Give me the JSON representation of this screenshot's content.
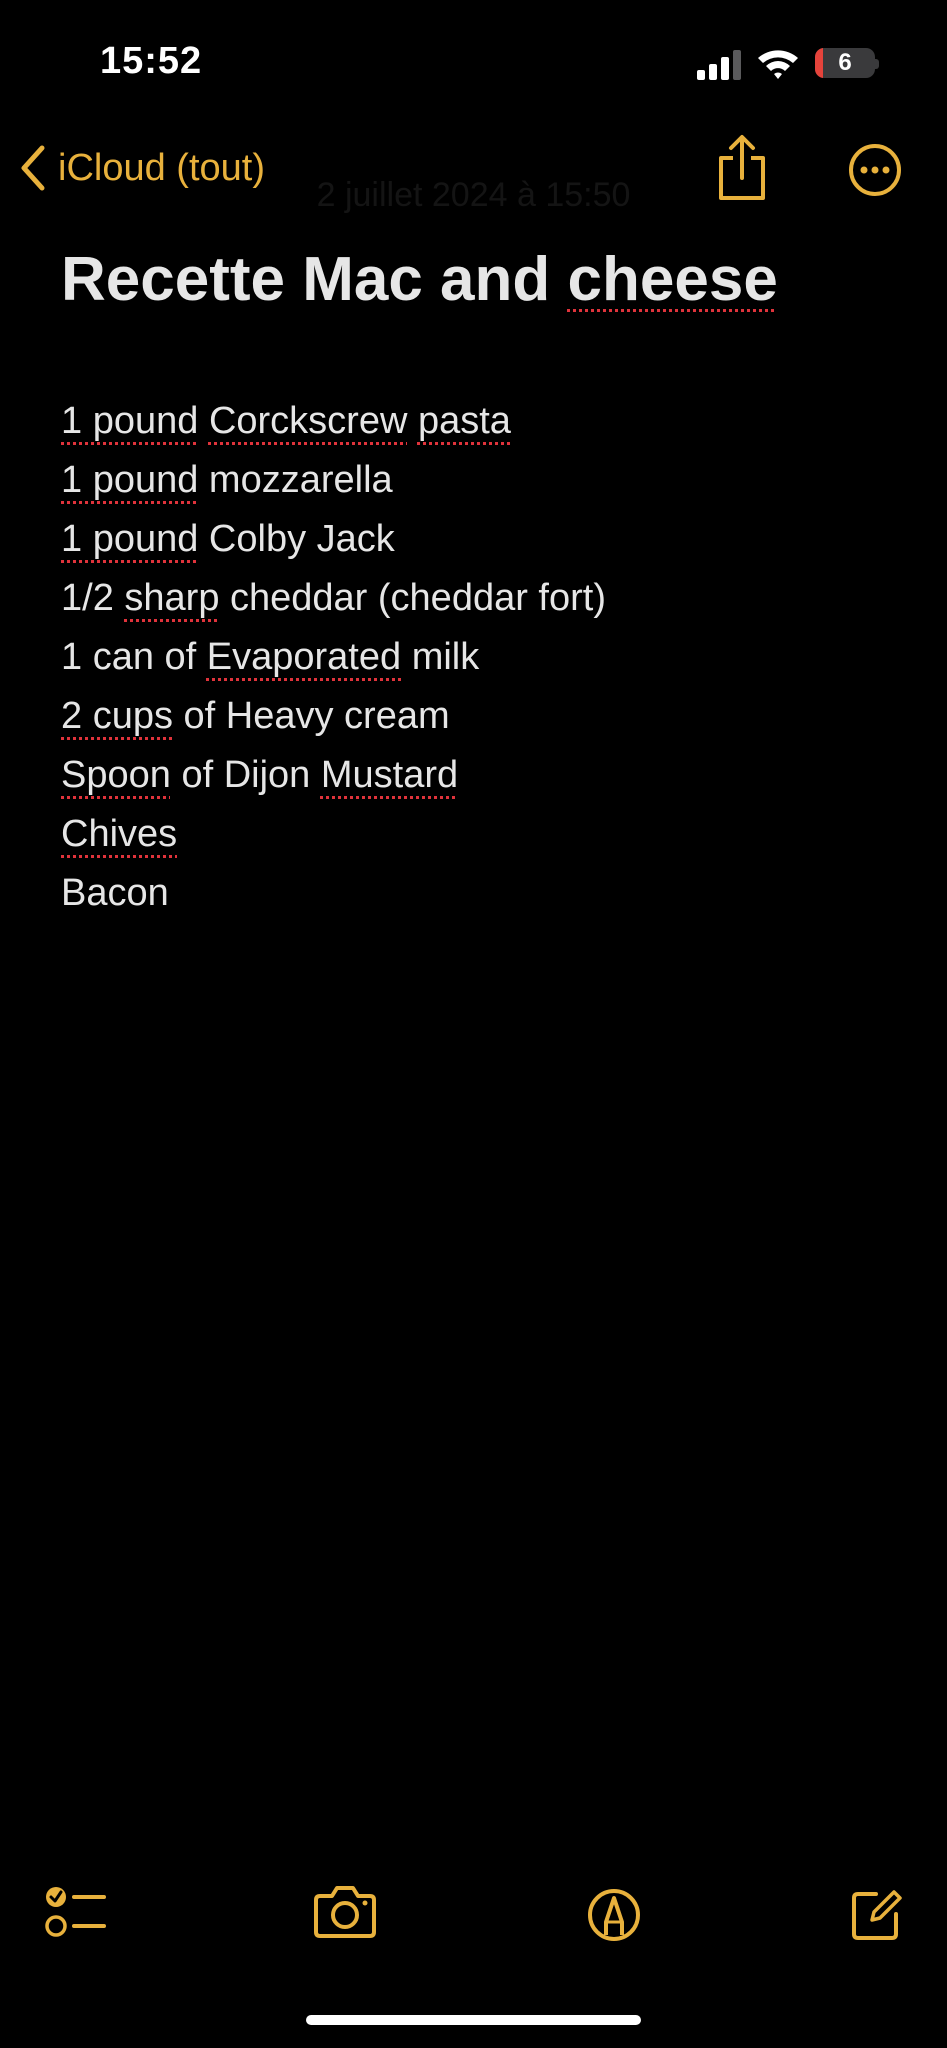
{
  "status": {
    "time": "15:52",
    "battery_level": "6",
    "battery_fraction": 0.06
  },
  "nav": {
    "back_label": "iCloud (tout)",
    "date": "2 juillet 2024 à 15:50"
  },
  "note": {
    "title": [
      "Recette Mac and ",
      "cheese"
    ],
    "ingredients": [
      [
        "1 pound",
        " ",
        "Corckscrew",
        " ",
        "pasta"
      ],
      [
        "1 pound",
        " mozzarella"
      ],
      [
        "1 pound",
        " Colby Jack"
      ],
      [
        "1/2 ",
        "sharp",
        " cheddar (cheddar fort)"
      ],
      [
        "1 can of ",
        "Evaporated",
        " milk"
      ],
      [
        "2 cups",
        " of Heavy cream"
      ],
      [
        "Spoon",
        " of Dijon ",
        "Mustard"
      ],
      [
        "Chives"
      ],
      [
        "Bacon"
      ]
    ]
  },
  "icons": {
    "back": "chevron-left-icon",
    "share": "share-icon",
    "more": "ellipsis-circle-icon",
    "checklist": "checklist-icon",
    "camera": "camera-icon",
    "markup": "pen-tip-circle-icon",
    "compose": "compose-icon"
  },
  "colors": {
    "accent": "#e8b13c",
    "background": "#000000",
    "text": "#e6e6e6",
    "spellcheck": "#e0333b",
    "battery_low": "#e5433b"
  }
}
